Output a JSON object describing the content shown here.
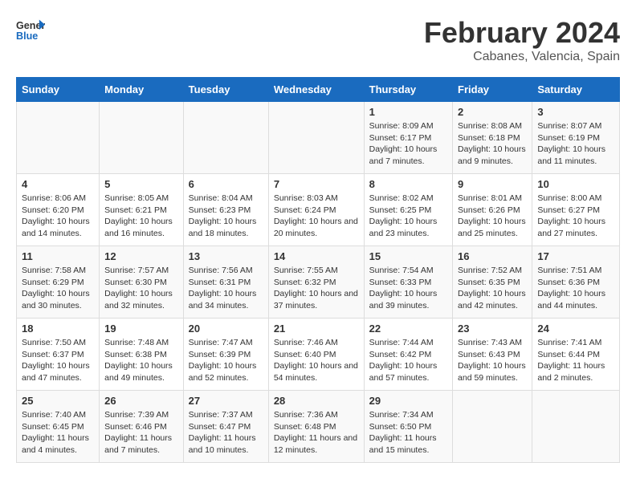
{
  "header": {
    "logo_general": "General",
    "logo_blue": "Blue",
    "month_title": "February 2024",
    "location": "Cabanes, Valencia, Spain"
  },
  "weekdays": [
    "Sunday",
    "Monday",
    "Tuesday",
    "Wednesday",
    "Thursday",
    "Friday",
    "Saturday"
  ],
  "weeks": [
    [
      {
        "day": "",
        "sunrise": "",
        "sunset": "",
        "daylight": ""
      },
      {
        "day": "",
        "sunrise": "",
        "sunset": "",
        "daylight": ""
      },
      {
        "day": "",
        "sunrise": "",
        "sunset": "",
        "daylight": ""
      },
      {
        "day": "",
        "sunrise": "",
        "sunset": "",
        "daylight": ""
      },
      {
        "day": "1",
        "sunrise": "8:09 AM",
        "sunset": "6:17 PM",
        "daylight": "10 hours and 7 minutes."
      },
      {
        "day": "2",
        "sunrise": "8:08 AM",
        "sunset": "6:18 PM",
        "daylight": "10 hours and 9 minutes."
      },
      {
        "day": "3",
        "sunrise": "8:07 AM",
        "sunset": "6:19 PM",
        "daylight": "10 hours and 11 minutes."
      }
    ],
    [
      {
        "day": "4",
        "sunrise": "8:06 AM",
        "sunset": "6:20 PM",
        "daylight": "10 hours and 14 minutes."
      },
      {
        "day": "5",
        "sunrise": "8:05 AM",
        "sunset": "6:21 PM",
        "daylight": "10 hours and 16 minutes."
      },
      {
        "day": "6",
        "sunrise": "8:04 AM",
        "sunset": "6:23 PM",
        "daylight": "10 hours and 18 minutes."
      },
      {
        "day": "7",
        "sunrise": "8:03 AM",
        "sunset": "6:24 PM",
        "daylight": "10 hours and 20 minutes."
      },
      {
        "day": "8",
        "sunrise": "8:02 AM",
        "sunset": "6:25 PM",
        "daylight": "10 hours and 23 minutes."
      },
      {
        "day": "9",
        "sunrise": "8:01 AM",
        "sunset": "6:26 PM",
        "daylight": "10 hours and 25 minutes."
      },
      {
        "day": "10",
        "sunrise": "8:00 AM",
        "sunset": "6:27 PM",
        "daylight": "10 hours and 27 minutes."
      }
    ],
    [
      {
        "day": "11",
        "sunrise": "7:58 AM",
        "sunset": "6:29 PM",
        "daylight": "10 hours and 30 minutes."
      },
      {
        "day": "12",
        "sunrise": "7:57 AM",
        "sunset": "6:30 PM",
        "daylight": "10 hours and 32 minutes."
      },
      {
        "day": "13",
        "sunrise": "7:56 AM",
        "sunset": "6:31 PM",
        "daylight": "10 hours and 34 minutes."
      },
      {
        "day": "14",
        "sunrise": "7:55 AM",
        "sunset": "6:32 PM",
        "daylight": "10 hours and 37 minutes."
      },
      {
        "day": "15",
        "sunrise": "7:54 AM",
        "sunset": "6:33 PM",
        "daylight": "10 hours and 39 minutes."
      },
      {
        "day": "16",
        "sunrise": "7:52 AM",
        "sunset": "6:35 PM",
        "daylight": "10 hours and 42 minutes."
      },
      {
        "day": "17",
        "sunrise": "7:51 AM",
        "sunset": "6:36 PM",
        "daylight": "10 hours and 44 minutes."
      }
    ],
    [
      {
        "day": "18",
        "sunrise": "7:50 AM",
        "sunset": "6:37 PM",
        "daylight": "10 hours and 47 minutes."
      },
      {
        "day": "19",
        "sunrise": "7:48 AM",
        "sunset": "6:38 PM",
        "daylight": "10 hours and 49 minutes."
      },
      {
        "day": "20",
        "sunrise": "7:47 AM",
        "sunset": "6:39 PM",
        "daylight": "10 hours and 52 minutes."
      },
      {
        "day": "21",
        "sunrise": "7:46 AM",
        "sunset": "6:40 PM",
        "daylight": "10 hours and 54 minutes."
      },
      {
        "day": "22",
        "sunrise": "7:44 AM",
        "sunset": "6:42 PM",
        "daylight": "10 hours and 57 minutes."
      },
      {
        "day": "23",
        "sunrise": "7:43 AM",
        "sunset": "6:43 PM",
        "daylight": "10 hours and 59 minutes."
      },
      {
        "day": "24",
        "sunrise": "7:41 AM",
        "sunset": "6:44 PM",
        "daylight": "11 hours and 2 minutes."
      }
    ],
    [
      {
        "day": "25",
        "sunrise": "7:40 AM",
        "sunset": "6:45 PM",
        "daylight": "11 hours and 4 minutes."
      },
      {
        "day": "26",
        "sunrise": "7:39 AM",
        "sunset": "6:46 PM",
        "daylight": "11 hours and 7 minutes."
      },
      {
        "day": "27",
        "sunrise": "7:37 AM",
        "sunset": "6:47 PM",
        "daylight": "11 hours and 10 minutes."
      },
      {
        "day": "28",
        "sunrise": "7:36 AM",
        "sunset": "6:48 PM",
        "daylight": "11 hours and 12 minutes."
      },
      {
        "day": "29",
        "sunrise": "7:34 AM",
        "sunset": "6:50 PM",
        "daylight": "11 hours and 15 minutes."
      },
      {
        "day": "",
        "sunrise": "",
        "sunset": "",
        "daylight": ""
      },
      {
        "day": "",
        "sunrise": "",
        "sunset": "",
        "daylight": ""
      }
    ]
  ]
}
